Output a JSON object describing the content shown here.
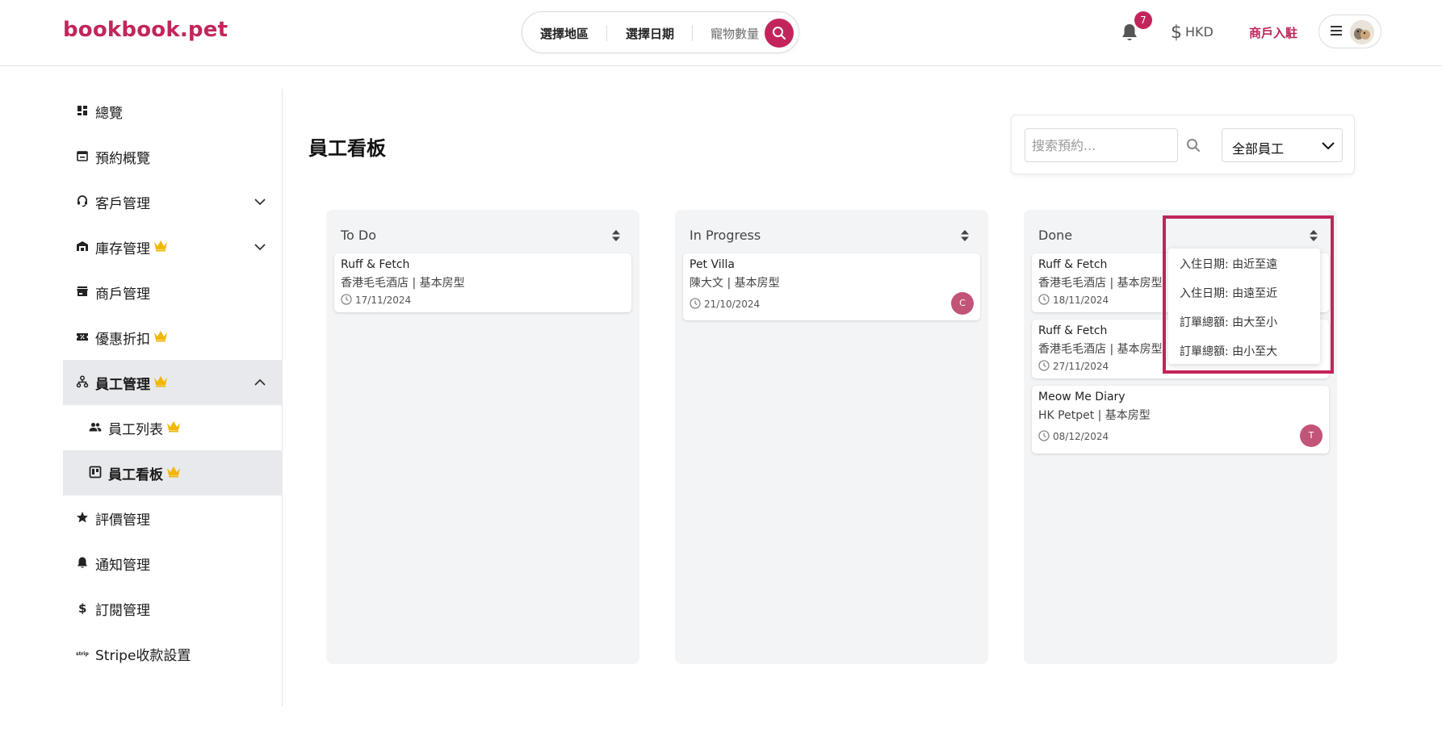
{
  "header": {
    "logo": "bookbook.pet",
    "search": {
      "location": "選擇地區",
      "date": "選擇日期",
      "pets": "寵物數量"
    },
    "notification_count": "7",
    "currency": "HKD",
    "merchant_link": "商戶入駐"
  },
  "sidebar": {
    "items": [
      {
        "label": "總覽"
      },
      {
        "label": "預約概覽"
      },
      {
        "label": "客戶管理"
      },
      {
        "label": "庫存管理"
      },
      {
        "label": "商戶管理"
      },
      {
        "label": "優惠折扣"
      },
      {
        "label": "員工管理"
      },
      {
        "label": "員工列表"
      },
      {
        "label": "員工看板"
      },
      {
        "label": "評價管理"
      },
      {
        "label": "通知管理"
      },
      {
        "label": "訂閱管理"
      },
      {
        "label": "Stripe收款設置"
      }
    ]
  },
  "main": {
    "title": "員工看板",
    "search_placeholder": "搜索預約...",
    "staff_filter": "全部員工"
  },
  "columns": [
    {
      "title": "To Do",
      "cards": [
        {
          "name": "Ruff & Fetch",
          "detail": "香港毛毛酒店 | 基本房型",
          "date": "17/11/2024"
        }
      ]
    },
    {
      "title": "In Progress",
      "cards": [
        {
          "name": "Pet Villa",
          "detail": "陳大文 | 基本房型",
          "date": "21/10/2024",
          "assignee": "C"
        }
      ]
    },
    {
      "title": "Done",
      "cards": [
        {
          "name": "Ruff & Fetch",
          "detail": "香港毛毛酒店 | 基本房型",
          "date": "18/11/2024"
        },
        {
          "name": "Ruff & Fetch",
          "detail": "香港毛毛酒店 | 基本房型",
          "date": "27/11/2024"
        },
        {
          "name": "Meow Me Diary",
          "detail": "HK Petpet | 基本房型",
          "date": "08/12/2024",
          "assignee": "T"
        }
      ]
    }
  ],
  "sort_menu": {
    "options": [
      "入住日期: 由近至遠",
      "入住日期: 由遠至近",
      "訂單總額: 由大至小",
      "訂單總額: 由小至大"
    ]
  },
  "colors": {
    "brand": "#c2255c",
    "crown": "#f2b705",
    "column_bg": "#f3f4f6",
    "active_nav": "#e8e9ec"
  }
}
